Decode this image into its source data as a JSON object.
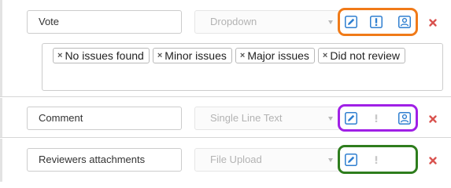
{
  "fields": [
    {
      "name": "Vote",
      "type": "Dropdown",
      "actions_color": "#f07a18",
      "required_active": true,
      "reviewer_active": true,
      "options": [
        "No issues found",
        "Minor issues",
        "Major issues",
        "Did not review"
      ]
    },
    {
      "name": "Comment",
      "type": "Single Line Text",
      "actions_color": "#a020e6",
      "required_active": false,
      "reviewer_active": true
    },
    {
      "name": "Reviewers attachments",
      "type": "File Upload",
      "actions_color": "#2e7d1d",
      "required_active": false,
      "reviewer_active": false
    }
  ],
  "icons": {
    "edit": "pencil-icon",
    "required": "exclamation-icon",
    "reviewer": "user-icon",
    "delete": "close-icon",
    "tag_remove": "×"
  },
  "colors": {
    "icon_blue": "#2f7fd0",
    "icon_disabled": "#c8c8c8",
    "delete_red": "#d9534f"
  }
}
